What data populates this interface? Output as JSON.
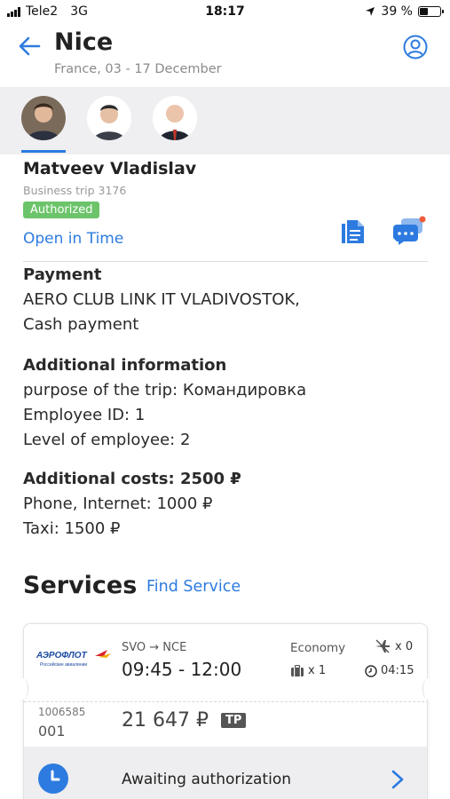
{
  "status_bar": {
    "carrier": "Tele2",
    "network": "3G",
    "time": "18:17",
    "battery": "39 %"
  },
  "header": {
    "title": "Nice",
    "subtitle": "France, 03 - 17 December"
  },
  "traveller": {
    "name": "Matveev Vladislav",
    "trip": "Business trip 3176",
    "status_badge": "Authorized",
    "open_link": "Open in Time"
  },
  "payment": {
    "heading": "Payment",
    "line1": "AERO CLUB LINK IT VLADIVOSTOK,",
    "line2": "Cash payment"
  },
  "additional": {
    "heading": "Additional information",
    "line1": "purpose of the trip: Командировка",
    "line2": "Employee ID: 1",
    "line3": "Level of employee: 2"
  },
  "costs": {
    "heading": "Additional costs: 2500 ₽",
    "line1": "Phone, Internet: 1000 ₽",
    "line2": "Taxi: 1500 ₽"
  },
  "services": {
    "title": "Services",
    "find_link": "Find Service"
  },
  "flight": {
    "airline_logo_text": "АЭРОФЛОТ",
    "airline_logo_sub": "Российские авиалинии",
    "route": "SVO → NCE",
    "times": "09:45 - 12:00",
    "class": "Economy",
    "transfers": "x 0",
    "baggage": "x 1",
    "duration": "04:15",
    "order_no": "1006585",
    "order_sub": "001",
    "price": "21 647 ₽",
    "tag": "TP",
    "status": "Awaiting authorization"
  },
  "colors": {
    "accent": "#2d7be0",
    "badge_green": "#6cc46a",
    "strip_bg": "#efeff1",
    "notification_dot": "#f05a3a"
  }
}
